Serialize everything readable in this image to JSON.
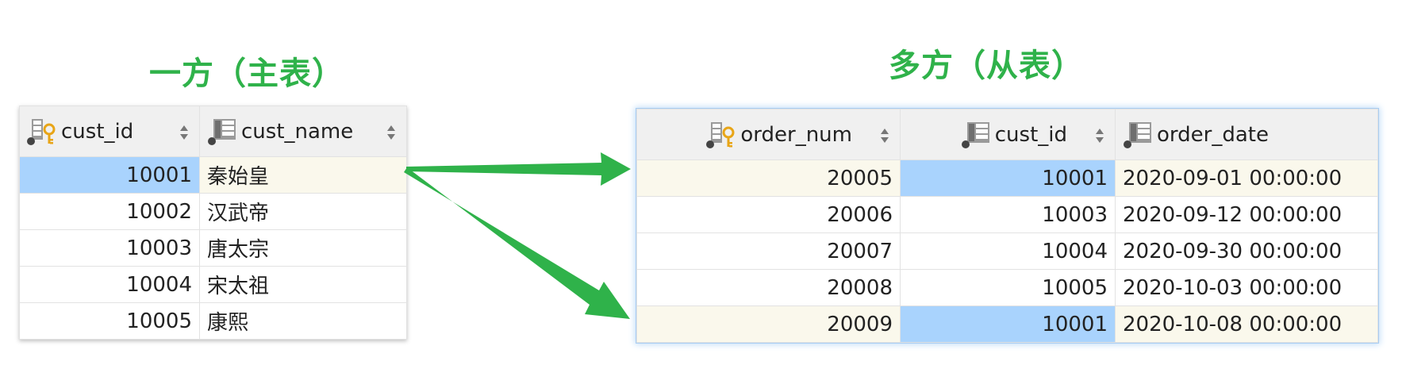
{
  "titles": {
    "left": "一方（主表）",
    "right": "多方（从表）"
  },
  "colors": {
    "title": "#2fb24a",
    "arrow": "#2fb24a",
    "selected_cell": "#a9d3fd",
    "highlight_row": "#faf8ec",
    "header_bg": "#f0f0f0"
  },
  "left_table": {
    "columns": [
      {
        "label": "cust_id",
        "icon": "primary-key-column-icon"
      },
      {
        "label": "cust_name",
        "icon": "column-icon"
      }
    ],
    "rows": [
      {
        "cust_id": "10001",
        "cust_name": "秦始皇"
      },
      {
        "cust_id": "10002",
        "cust_name": "汉武帝"
      },
      {
        "cust_id": "10003",
        "cust_name": "唐太宗"
      },
      {
        "cust_id": "10004",
        "cust_name": "宋太祖"
      },
      {
        "cust_id": "10005",
        "cust_name": "康熙"
      }
    ]
  },
  "right_table": {
    "columns": [
      {
        "label": "order_num",
        "icon": "primary-key-column-icon"
      },
      {
        "label": "cust_id",
        "icon": "column-icon"
      },
      {
        "label": "order_date",
        "icon": "column-icon"
      }
    ],
    "rows": [
      {
        "order_num": "20005",
        "cust_id": "10001",
        "order_date": "2020-09-01 00:00:00"
      },
      {
        "order_num": "20006",
        "cust_id": "10003",
        "order_date": "2020-09-12 00:00:00"
      },
      {
        "order_num": "20007",
        "cust_id": "10004",
        "order_date": "2020-09-30 00:00:00"
      },
      {
        "order_num": "20008",
        "cust_id": "10005",
        "order_date": "2020-10-03 00:00:00"
      },
      {
        "order_num": "20009",
        "cust_id": "10001",
        "order_date": "2020-10-08 00:00:00"
      }
    ]
  }
}
